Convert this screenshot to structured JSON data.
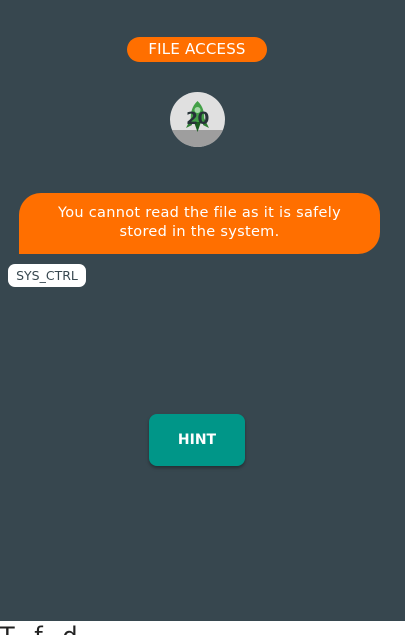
{
  "header": {
    "title": "FILE ACCESS"
  },
  "level": {
    "number": "20"
  },
  "message": {
    "text": "You cannot read the file as it is safely stored in the system.",
    "sender": "SYS_CTRL"
  },
  "actions": {
    "hint_label": "HINT"
  },
  "colors": {
    "background": "#37474f",
    "accent_orange": "#ff6f00",
    "button_teal": "#009688",
    "badge_gray": "#e0e0e0",
    "icon_green": "#4caf50"
  },
  "icons": {
    "badge_icon": "rocket-icon"
  },
  "bottom_strip": {
    "text": "T   f         d"
  }
}
